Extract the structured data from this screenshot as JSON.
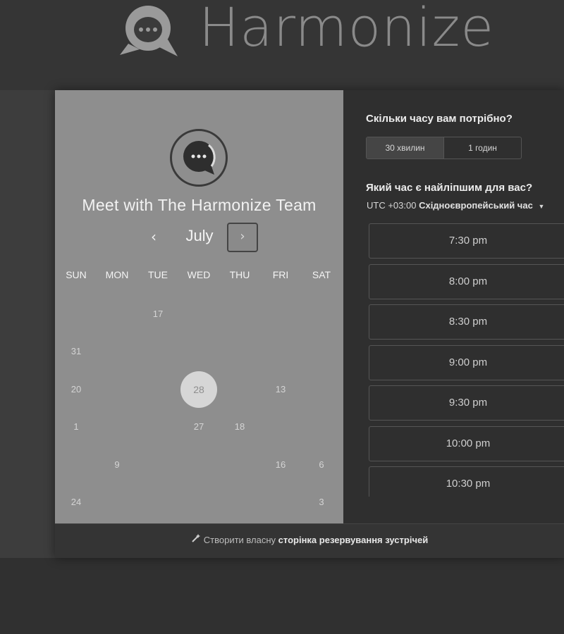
{
  "header": {
    "brand": "Harmonize",
    "logo_icon": "chat-bubble-logo"
  },
  "calendar": {
    "avatar_icon": "chat-bubble-logo",
    "title": "Meet with The Harmonize Team",
    "month": "July",
    "prev_label": "‹",
    "next_label": "›",
    "weekdays": [
      "SUN",
      "MON",
      "TUE",
      "WED",
      "THU",
      "FRI",
      "SAT"
    ],
    "days": [
      {
        "label": "17",
        "col": 2,
        "row": 0
      },
      {
        "label": "31",
        "col": 0,
        "row": 1
      },
      {
        "label": "20",
        "col": 0,
        "row": 2
      },
      {
        "label": "28",
        "col": 3,
        "row": 2,
        "selected": true
      },
      {
        "label": "13",
        "col": 5,
        "row": 2
      },
      {
        "label": "1",
        "col": 0,
        "row": 3
      },
      {
        "label": "27",
        "col": 3,
        "row": 3
      },
      {
        "label": "18",
        "col": 4,
        "row": 3
      },
      {
        "label": "9",
        "col": 1,
        "row": 4
      },
      {
        "label": "16",
        "col": 5,
        "row": 4
      },
      {
        "label": "6",
        "col": 6,
        "row": 4
      },
      {
        "label": "24",
        "col": 0,
        "row": 5
      },
      {
        "label": "3",
        "col": 6,
        "row": 5
      }
    ]
  },
  "booking": {
    "duration_question": "Скільки часу вам потрібно?",
    "durations": [
      {
        "label": "30 хвилин",
        "active": true
      },
      {
        "label": "1 годин",
        "active": false
      }
    ],
    "time_question": "Який час є найліпшим для вас?",
    "timezone_prefix": "UTC +03:00",
    "timezone_name": "Східноєвропейський час",
    "timezone_caret": "▼",
    "slots": [
      "7:30 pm",
      "8:00 pm",
      "8:30 pm",
      "9:00 pm",
      "9:30 pm",
      "10:00 pm",
      "10:30 pm"
    ]
  },
  "footer": {
    "icon": "magic-wand-icon",
    "text": "Створити власну",
    "link": "сторінка резервування зустрічей"
  }
}
